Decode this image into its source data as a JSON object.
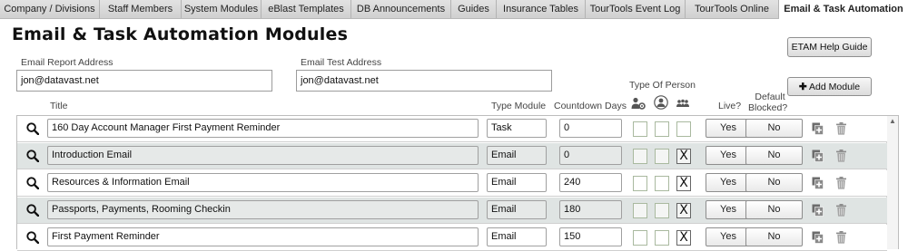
{
  "tabs": [
    {
      "label": "Company / Divisions",
      "active": false
    },
    {
      "label": "Staff Members",
      "active": false
    },
    {
      "label": "System Modules",
      "active": false
    },
    {
      "label": "eBlast Templates",
      "active": false
    },
    {
      "label": "DB Announcements",
      "active": false
    },
    {
      "label": "Guides",
      "active": false
    },
    {
      "label": "Insurance Tables",
      "active": false
    },
    {
      "label": "TourTools Event Log",
      "active": false
    },
    {
      "label": "TourTools Online",
      "active": false
    },
    {
      "label": "Email & Task Automation",
      "active": true
    }
  ],
  "page": {
    "title": "Email & Task Automation Modules",
    "help_button": "ETAM Help Guide",
    "add_button": "Add Module"
  },
  "fields": {
    "report_label": "Email Report Address",
    "report_value": "jon@datavast.net",
    "test_label": "Email Test Address",
    "test_value": "jon@datavast.net"
  },
  "columns": {
    "title": "Title",
    "type_module": "Type Module",
    "countdown_days": "Countdown Days",
    "type_of_person": "Type Of Person",
    "live": "Live?",
    "default_blocked_1": "Default",
    "default_blocked_2": "Blocked?"
  },
  "rows": [
    {
      "title": "160 Day Account Manager First Payment Reminder",
      "type": "Task",
      "days": "0",
      "person1": "",
      "person2": "",
      "person3": "",
      "live": "Yes",
      "blocked": "No"
    },
    {
      "title": "Introduction Email",
      "type": "Email",
      "days": "0",
      "person1": "",
      "person2": "",
      "person3": "X",
      "live": "Yes",
      "blocked": "No"
    },
    {
      "title": "Resources & Information Email",
      "type": "Email",
      "days": "240",
      "person1": "",
      "person2": "",
      "person3": "X",
      "live": "Yes",
      "blocked": "No"
    },
    {
      "title": "Passports, Payments, Rooming Checkin",
      "type": "Email",
      "days": "180",
      "person1": "",
      "person2": "",
      "person3": "X",
      "live": "Yes",
      "blocked": "No"
    },
    {
      "title": "First Payment Reminder",
      "type": "Email",
      "days": "150",
      "person1": "",
      "person2": "",
      "person3": "X",
      "live": "Yes",
      "blocked": "No"
    }
  ],
  "icons": {
    "row_search": "search-icon",
    "row_duplicate": "duplicate-icon",
    "row_delete": "trash-icon",
    "person_staff": "staff-gear-icon",
    "person_single": "person-icon",
    "person_group": "group-icon",
    "add": "plus-icon"
  },
  "colors": {
    "tab_bar": "#d9d9d9",
    "active_tab": "#ffffff",
    "odd_row": "#dfe4e3",
    "checkbox_border": "#a9b99f"
  }
}
